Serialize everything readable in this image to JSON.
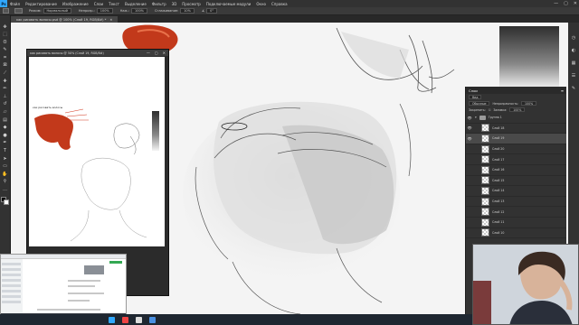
{
  "app": {
    "logo_text": "Ps",
    "menu": [
      "Файл",
      "Редактирование",
      "Изображение",
      "Слои",
      "Текст",
      "Выделение",
      "Фильтр",
      "3D",
      "Просмотр",
      "Подключаемые модули",
      "Окно",
      "Справка"
    ],
    "window_controls": [
      "—",
      "▢",
      "✕"
    ]
  },
  "options": {
    "mode_label": "Режим:",
    "mode_value": "Нормальный",
    "opacity_label": "Непрозр.:",
    "opacity_value": "100%",
    "flow_label": "Наж.:",
    "flow_value": "100%",
    "smoothing_label": "Сглаживание:",
    "smoothing_value": "10%",
    "angle_value": "0°"
  },
  "document_tab": {
    "title": "как рисовать волосы.psd @ 100% (Слой 19, RGB/8#) *",
    "close": "✕"
  },
  "toolbar": {
    "tools": [
      {
        "icon": "move-icon",
        "glyph": "✥"
      },
      {
        "icon": "marquee-icon",
        "glyph": "⬚"
      },
      {
        "icon": "lasso-icon",
        "glyph": "ʘ"
      },
      {
        "icon": "quick-select-icon",
        "glyph": "✎"
      },
      {
        "icon": "crop-icon",
        "glyph": "⌗"
      },
      {
        "icon": "frame-icon",
        "glyph": "⊠"
      },
      {
        "icon": "eyedropper-icon",
        "glyph": "⟋"
      },
      {
        "icon": "healing-icon",
        "glyph": "✚"
      },
      {
        "icon": "brush-icon",
        "glyph": "✏"
      },
      {
        "icon": "stamp-icon",
        "glyph": "⊥"
      },
      {
        "icon": "history-brush-icon",
        "glyph": "↺"
      },
      {
        "icon": "eraser-icon",
        "glyph": "▱"
      },
      {
        "icon": "gradient-icon",
        "glyph": "▤"
      },
      {
        "icon": "blur-icon",
        "glyph": "◆"
      },
      {
        "icon": "dodge-icon",
        "glyph": "●"
      },
      {
        "icon": "pen-icon",
        "glyph": "✒"
      },
      {
        "icon": "type-icon",
        "glyph": "T"
      },
      {
        "icon": "path-select-icon",
        "glyph": "➤"
      },
      {
        "icon": "shape-icon",
        "glyph": "▭"
      },
      {
        "icon": "hand-icon",
        "glyph": "✋"
      },
      {
        "icon": "zoom-icon",
        "glyph": "⚲"
      },
      {
        "icon": "more-tools-icon",
        "glyph": "…"
      }
    ],
    "fg_color": "#000000",
    "bg_color": "#ffffff"
  },
  "navigator": {
    "title": "как рисовать волосы @ 50% (Слой 19, RGB/8#)",
    "controls": [
      "—",
      "▢",
      "✕"
    ],
    "ref_title": "как рисовать волосы"
  },
  "layers": {
    "title": "Слои",
    "menu_icon": "≡",
    "filter_label": "Вид",
    "blend_mode": "Обычные",
    "opacity_label": "Непрозрачность:",
    "opacity_value": "100%",
    "lock_label": "Закрепить:",
    "fill_label": "Заливка:",
    "fill_value": "100%",
    "group_name": "Группа 1",
    "items": [
      {
        "name": "Слой 18",
        "visible": true,
        "selected": false
      },
      {
        "name": "Слой 19",
        "visible": true,
        "selected": true
      },
      {
        "name": "Слой 20",
        "visible": false,
        "selected": false
      },
      {
        "name": "Слой 17",
        "visible": false,
        "selected": false
      },
      {
        "name": "Слой 16",
        "visible": false,
        "selected": false
      },
      {
        "name": "Слой 15",
        "visible": false,
        "selected": false
      },
      {
        "name": "Слой 14",
        "visible": false,
        "selected": false
      },
      {
        "name": "Слой 13",
        "visible": false,
        "selected": false
      },
      {
        "name": "Слой 12",
        "visible": false,
        "selected": false
      },
      {
        "name": "Слой 11",
        "visible": false,
        "selected": false
      },
      {
        "name": "Слой 10",
        "visible": false,
        "selected": false
      }
    ]
  },
  "colors": {
    "accent": "#31a8ff",
    "hair_red": "#c2391b",
    "panel": "#323232"
  }
}
